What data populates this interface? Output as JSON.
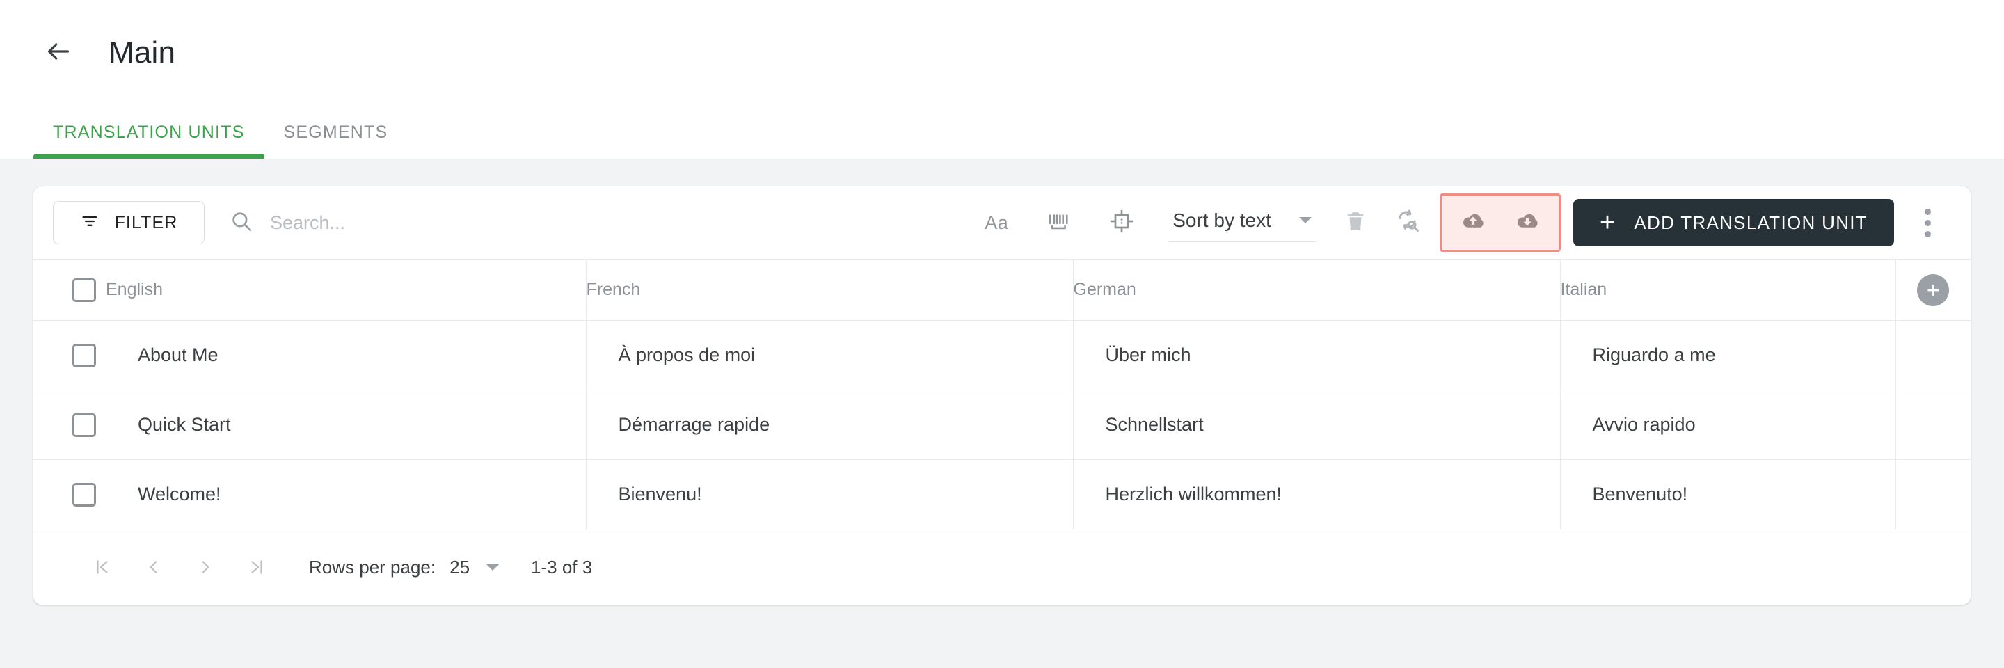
{
  "header": {
    "back_icon": "arrow-left-icon",
    "title": "Main"
  },
  "tabs": [
    {
      "label": "TRANSLATION UNITS",
      "active": true
    },
    {
      "label": "SEGMENTS",
      "active": false
    }
  ],
  "toolbar": {
    "filter_label": "FILTER",
    "filter_icon": "filter-icon",
    "search_icon": "search-icon",
    "search_value": "",
    "search_placeholder": "Search...",
    "match_case_label": "Aa",
    "whole_word_icon": "whole-word-icon",
    "regex_icon": "selection-crop-icon",
    "sort_label": "Sort by text",
    "delete_icon": "trash-icon",
    "find_replace_icon": "find-replace-icon",
    "import_icon": "cloud-upload-icon",
    "export_icon": "cloud-download-icon",
    "add_unit_label": "ADD TRANSLATION UNIT",
    "add_unit_plus": "+",
    "more_icon": "kebab-menu-icon",
    "highlight_color": "#f28b82",
    "highlight_fill": "#fdebea"
  },
  "table": {
    "columns": [
      "English",
      "French",
      "German",
      "Italian"
    ],
    "add_column_label": "+",
    "rows": [
      {
        "english": "About Me",
        "french": "À propos de moi",
        "german": "Über mich",
        "italian": "Riguardo a me"
      },
      {
        "english": "Quick Start",
        "french": "Démarrage rapide",
        "german": "Schnellstart",
        "italian": "Avvio rapido"
      },
      {
        "english": "Welcome!",
        "french": "Bienvenu!",
        "german": "Herzlich willkommen!",
        "italian": "Benvenuto!"
      }
    ]
  },
  "paginator": {
    "first_label": "|<",
    "prev_label": "<",
    "next_label": ">",
    "last_label": ">|",
    "rows_per_page_label": "Rows per page:",
    "rows_per_page_value": "25",
    "range_label": "1-3 of 3"
  },
  "theme": {
    "accent_green": "#3ba14a",
    "dark_button": "#263238",
    "page_bg": "#f1f3f4"
  }
}
